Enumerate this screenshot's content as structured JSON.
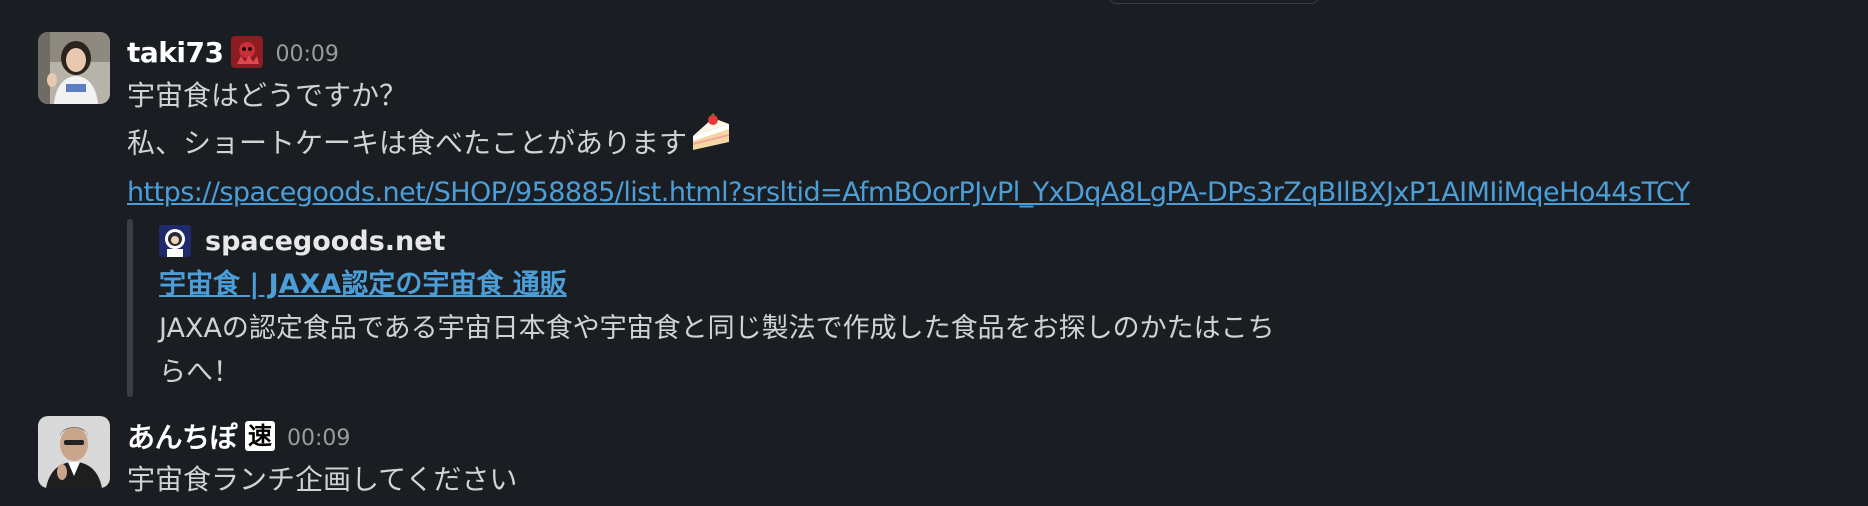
{
  "messages": [
    {
      "sender": "taki73",
      "time": "00:09",
      "lines": [
        "宇宙食はどうですか？",
        "私、ショートケーキは食べたことがあります"
      ],
      "emoji": "shortcake-icon",
      "link": "https://spacegoods.net/SHOP/958885/list.html?srsltid=AfmBOorPJvPl_YxDqA8LgPA-DPs3rZqBIlBXJxP1AIMIiMqeHo44sTCY",
      "unfurl": {
        "site": "spacegoods.net",
        "title": "宇宙食 | JAXA認定の宇宙食 通販",
        "description": "JAXAの認定食品である宇宙日本食や宇宙食と同じ製法で作成した食品をお探しのかたはこちらへ！"
      }
    },
    {
      "sender": "あんちぽ",
      "status_glyph": "速",
      "time": "00:09",
      "lines": [
        "宇宙食ランチ企画してください"
      ]
    }
  ],
  "colors": {
    "background": "#1a1d21",
    "text": "#d1d2d3",
    "link": "#4c9ed8",
    "timestamp": "#9a9b9e",
    "unfurl_bar": "#3b3e43"
  }
}
